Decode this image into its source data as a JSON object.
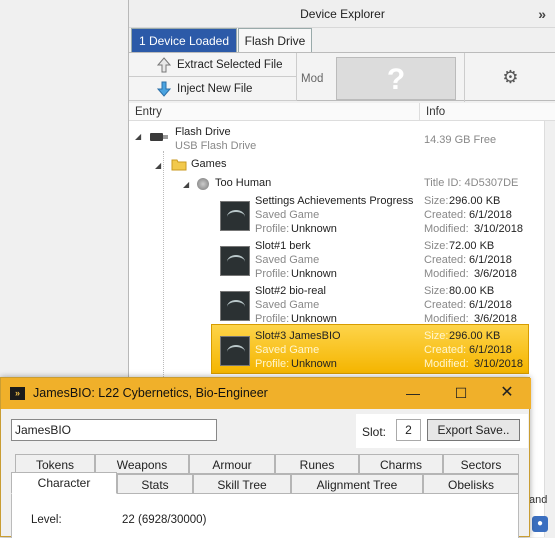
{
  "explorer": {
    "title": "Device Explorer",
    "tabs": [
      {
        "label": "1 Device Loaded"
      },
      {
        "label": "Flash Drive"
      }
    ],
    "extract_label": "Extract Selected File",
    "inject_label": "Inject New File",
    "mod_label": "Mod",
    "mod_placeholder": "?",
    "columns": {
      "entry": "Entry",
      "info": "Info"
    },
    "device": {
      "name": "Flash Drive",
      "sub": "USB Flash Drive",
      "free": "14.39 GB Free"
    },
    "folder": "Games",
    "game": {
      "name": "Too Human",
      "title_id": "Title ID: 4D5307DE"
    },
    "files": [
      {
        "name": "Settings  Achievements Progress",
        "type": "Saved Game",
        "profile_label": "Profile:",
        "profile": "Unknown",
        "size_label": "Size:",
        "size": "296.00 KB",
        "created_label": "Created:",
        "created": "6/1/2018",
        "modified_label": "Modified:",
        "modified": "3/10/2018"
      },
      {
        "name": "Slot#1 berk",
        "type": "Saved Game",
        "profile_label": "Profile:",
        "profile": "Unknown",
        "size_label": "Size:",
        "size": "72.00 KB",
        "created_label": "Created:",
        "created": "6/1/2018",
        "modified_label": "Modified:",
        "modified": "3/6/2018"
      },
      {
        "name": "Slot#2 bio-real",
        "type": "Saved Game",
        "profile_label": "Profile:",
        "profile": "Unknown",
        "size_label": "Size:",
        "size": "80.00 KB",
        "created_label": "Created:",
        "created": "6/1/2018",
        "modified_label": "Modified:",
        "modified": "3/6/2018"
      },
      {
        "name": "Slot#3 JamesBIO",
        "type": "Saved Game",
        "profile_label": "Profile:",
        "profile": "Unknown",
        "size_label": "Size:",
        "size": "296.00 KB",
        "created_label": "Created:",
        "created": "6/1/2018",
        "modified_label": "Modified:",
        "modified": "3/10/2018"
      }
    ],
    "side_fragment": "and"
  },
  "charwin": {
    "title": "JamesBIO: L22 Cybernetics, Bio-Engineer",
    "name_value": "JamesBIO",
    "slot_label": "Slot:",
    "slot_value": "2",
    "export_label": "Export Save..",
    "tabs_back": [
      "Tokens",
      "Weapons",
      "Armour",
      "Runes",
      "Charms",
      "Sectors"
    ],
    "tabs_front": [
      "Character",
      "Stats",
      "Skill Tree",
      "Alignment Tree",
      "Obelisks"
    ],
    "level_label": "Level:",
    "level_value": "22 (6928/30000)"
  }
}
